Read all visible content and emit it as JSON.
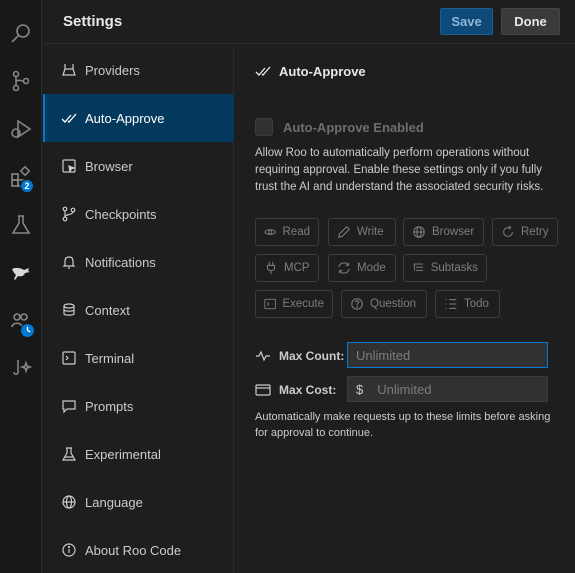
{
  "header": {
    "title": "Settings",
    "save_label": "Save",
    "done_label": "Done"
  },
  "activity_bar": {
    "extensions_badge": "2"
  },
  "sidebar": {
    "items": [
      {
        "label": "Providers",
        "icon": "providers-icon"
      },
      {
        "label": "Auto-Approve",
        "icon": "check-check-icon",
        "active": true
      },
      {
        "label": "Browser",
        "icon": "browser-icon"
      },
      {
        "label": "Checkpoints",
        "icon": "git-branch-icon"
      },
      {
        "label": "Notifications",
        "icon": "bell-icon"
      },
      {
        "label": "Context",
        "icon": "database-icon"
      },
      {
        "label": "Terminal",
        "icon": "terminal-icon"
      },
      {
        "label": "Prompts",
        "icon": "message-icon"
      },
      {
        "label": "Experimental",
        "icon": "flask-icon"
      },
      {
        "label": "Language",
        "icon": "globe-icon"
      },
      {
        "label": "About Roo Code",
        "icon": "info-icon"
      }
    ]
  },
  "main": {
    "section_title": "Auto-Approve",
    "enabled_label": "Auto-Approve Enabled",
    "description": "Allow Roo to automatically perform operations without requiring approval. Enable these settings only if you fully trust the AI and understand the associated security risks.",
    "chips": [
      "Read",
      "Write",
      "Browser",
      "Retry",
      "MCP",
      "Mode",
      "Subtasks",
      "Execute",
      "Question",
      "Todo"
    ],
    "max_count_label": "Max Count:",
    "max_count_placeholder": "Unlimited",
    "max_cost_label": "Max Cost:",
    "max_cost_prefix": "$",
    "max_cost_placeholder": "Unlimited",
    "footer": "Automatically make requests up to these limits before asking for approval to continue."
  },
  "colors": {
    "accent": "#0078d4",
    "active_bg": "#04395e",
    "background": "#1e1e1e"
  }
}
